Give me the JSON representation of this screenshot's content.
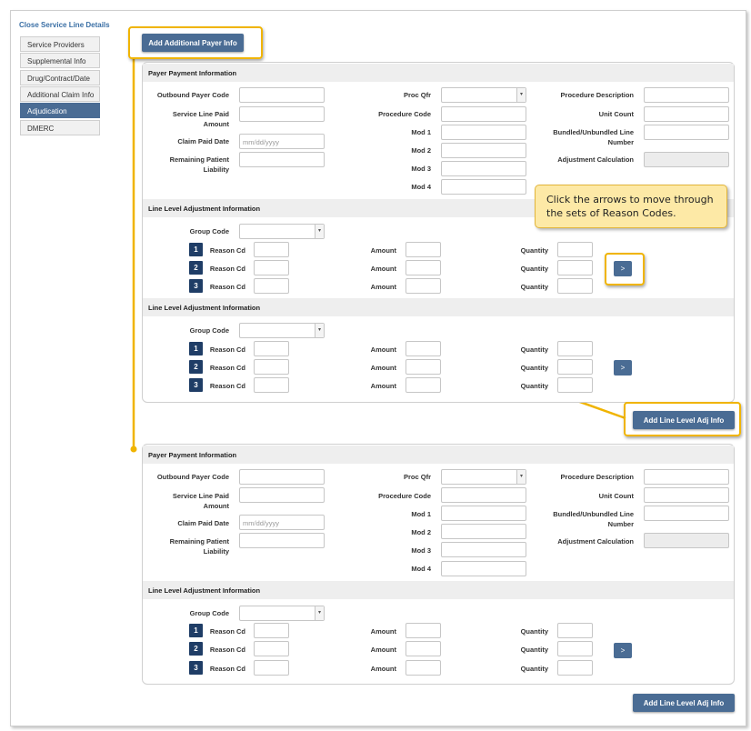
{
  "title": "Close Service Line Details",
  "nav": [
    "Service Providers",
    "Supplemental Info",
    "Drug/Contract/Date",
    "Additional Claim Info",
    "Adjudication",
    "DMERC"
  ],
  "add_payer_button": "Add Additional Payer Info",
  "add_line_button": "Add Line Level Adj Info",
  "callout": "Click the arrows to move through the sets of Reason Codes.",
  "payer": {
    "header": "Payer Payment Information",
    "outbound_payer_code": "Outbound Payer Code",
    "service_line_paid": "Service Line Paid",
    "amount": "Amount",
    "claim_paid_date": "Claim Paid Date",
    "date_placeholder": "mm/dd/yyyy",
    "remaining_patient": "Remaining Patient",
    "liability": "Liability",
    "proc_qfr": "Proc Qfr",
    "procedure_code": "Procedure Code",
    "mod1": "Mod 1",
    "mod2": "Mod 2",
    "mod3": "Mod 3",
    "mod4": "Mod 4",
    "procedure_description": "Procedure Description",
    "unit_count": "Unit Count",
    "bundled_line": "Bundled/Unbundled Line",
    "number": "Number",
    "adjustment_calculation": "Adjustment Calculation"
  },
  "adj": {
    "header": "Line Level Adjustment Information",
    "group_code": "Group Code",
    "reason_cd": "Reason Cd",
    "amount": "Amount",
    "quantity": "Quantity",
    "row_numbers": [
      "1",
      "2",
      "3"
    ],
    "arrow": ">"
  },
  "colors": {
    "accent": "#4a6c94",
    "highlight": "#f0b400",
    "callout_bg": "#fde9a6"
  }
}
